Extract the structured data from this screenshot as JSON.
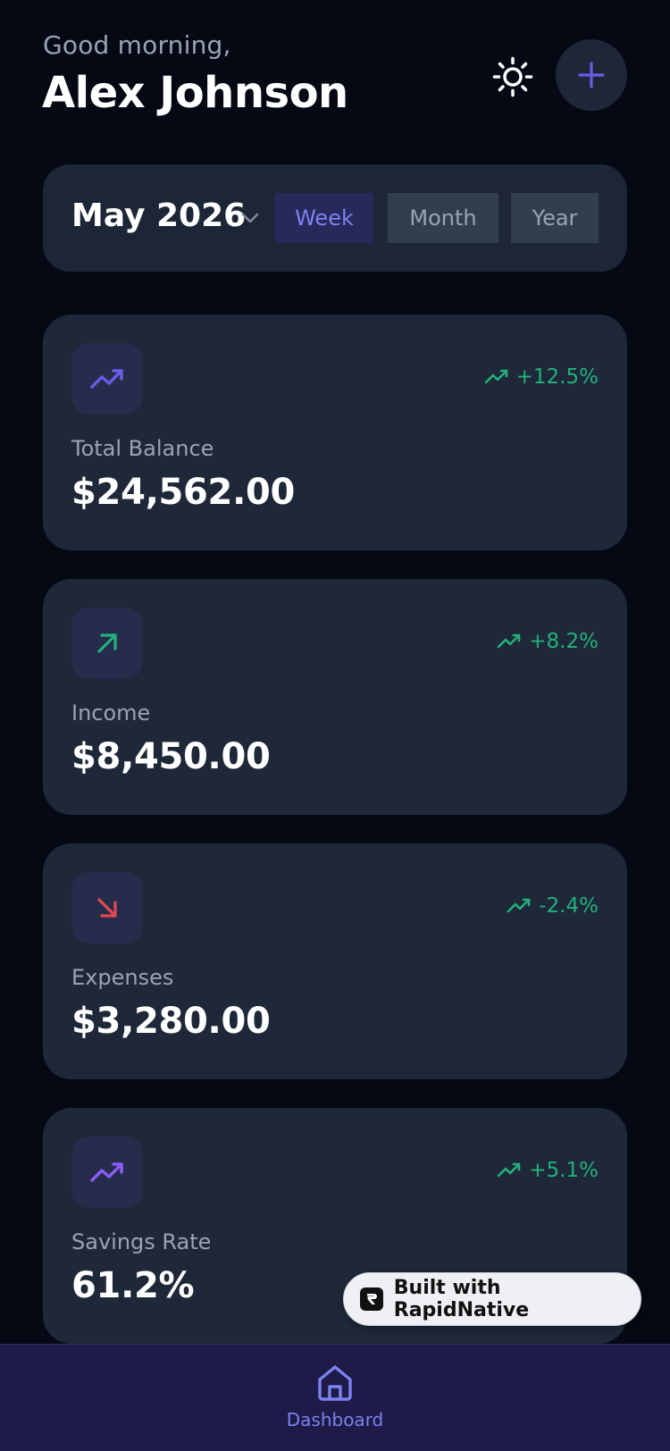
{
  "header": {
    "greeting": "Good morning,",
    "name": "Alex Johnson",
    "theme_icon": "sun-icon",
    "add_icon": "plus-icon"
  },
  "period": {
    "month": "May 2026",
    "tabs": [
      {
        "label": "Week",
        "active": true
      },
      {
        "label": "Month",
        "active": false
      },
      {
        "label": "Year",
        "active": false
      }
    ]
  },
  "stats": [
    {
      "label": "Total Balance",
      "value": "$24,562.00",
      "change": "+12.5%",
      "icon": "trending-up-icon"
    },
    {
      "label": "Income",
      "value": "$8,450.00",
      "change": "+8.2%",
      "icon": "arrow-up-right-icon"
    },
    {
      "label": "Expenses",
      "value": "$3,280.00",
      "change": "-2.4%",
      "icon": "arrow-down-right-icon"
    },
    {
      "label": "Savings Rate",
      "value": "61.2%",
      "change": "+5.1%",
      "icon": "trending-up-icon"
    }
  ],
  "badge": {
    "text": "Built with RapidNative"
  },
  "nav": {
    "home_label": "Dashboard"
  },
  "colors": {
    "background": "#050914",
    "card": "#1e2839",
    "accent": "#6b5ce7",
    "positive": "#23b07c",
    "negative": "#e5484d",
    "nav": "#1e1b48"
  }
}
